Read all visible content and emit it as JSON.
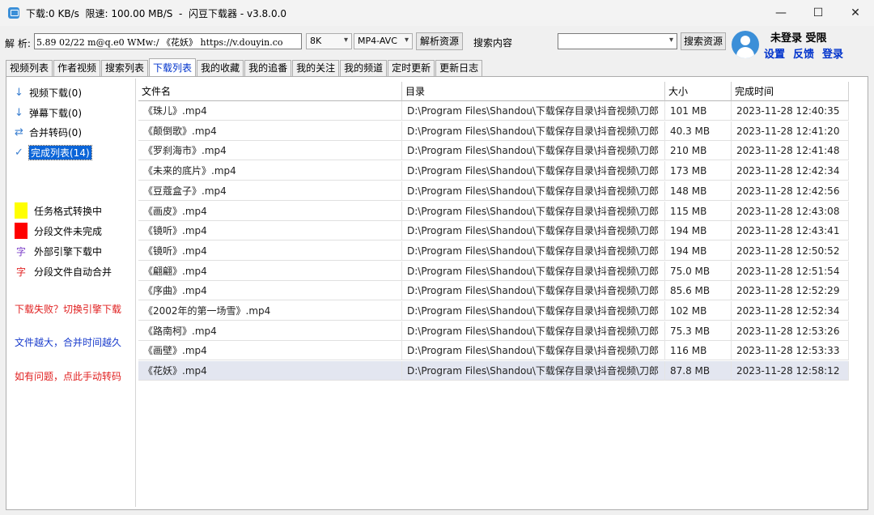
{
  "window": {
    "title": "下载:0 KB/s  限速: 100.00 MB/S  -  闪豆下载器 - v3.8.0.0",
    "controls": {
      "minimize": "—",
      "maximize": "☐",
      "close": "✕"
    }
  },
  "toolbar": {
    "parse_label": "解 析:",
    "url_value": "5.89 02/22 m@q.e0 WMw:/ 《花妖》  https://v.douyin.co",
    "quality_value": "8K",
    "format_value": "MP4-AVC",
    "parse_button": "解析资源",
    "search_label": "搜索内容",
    "search_value": "",
    "search_button": "搜索资源"
  },
  "user": {
    "status": "未登录  受限",
    "settings": "设置",
    "feedback": "反馈",
    "login": "登录"
  },
  "tabs": [
    {
      "label": "视频列表"
    },
    {
      "label": "作者视频"
    },
    {
      "label": "搜索列表"
    },
    {
      "label": "下载列表",
      "active": true
    },
    {
      "label": "我的收藏"
    },
    {
      "label": "我的追番"
    },
    {
      "label": "我的关注"
    },
    {
      "label": "我的频道"
    },
    {
      "label": "定时更新"
    },
    {
      "label": "更新日志"
    }
  ],
  "nav": [
    {
      "icon": "↓",
      "label": "视频下载(0)"
    },
    {
      "icon": "↓",
      "label": "弹幕下载(0)"
    },
    {
      "icon": "⇄",
      "label": "合并转码(0)"
    },
    {
      "icon": "✓",
      "label": "完成列表(14)",
      "selected": true
    }
  ],
  "legend": [
    {
      "color": "#ffff00",
      "label": "任务格式转换中"
    },
    {
      "color": "#ff0000",
      "label": "分段文件未完成"
    },
    {
      "char": "字",
      "char_color": "#7a3cc8",
      "label": "外部引擎下载中"
    },
    {
      "char": "字",
      "char_color": "#e02020",
      "label": "分段文件自动合并"
    }
  ],
  "notes": [
    {
      "text": "下载失败？切换引擎下载",
      "color": "#e02020"
    },
    {
      "text": "文件越大，合并时间越久",
      "color": "#1a3ccc"
    },
    {
      "text": "如有问题，点此手动转码",
      "color": "#e02020"
    }
  ],
  "table": {
    "columns": [
      "文件名",
      "目录",
      "大小",
      "完成时间"
    ],
    "rows": [
      {
        "name": "《珠儿》.mp4",
        "dir": "D:\\Program Files\\Shandou\\下载保存目录\\抖音视频\\刀郎",
        "size": "101 MB",
        "time": "2023-11-28 12:40:35"
      },
      {
        "name": "《颠倒歌》.mp4",
        "dir": "D:\\Program Files\\Shandou\\下载保存目录\\抖音视频\\刀郎",
        "size": "40.3 MB",
        "time": "2023-11-28 12:41:20"
      },
      {
        "name": "《罗刹海市》.mp4",
        "dir": "D:\\Program Files\\Shandou\\下载保存目录\\抖音视频\\刀郎",
        "size": "210 MB",
        "time": "2023-11-28 12:41:48"
      },
      {
        "name": "《未来的底片》.mp4",
        "dir": "D:\\Program Files\\Shandou\\下载保存目录\\抖音视频\\刀郎",
        "size": "173 MB",
        "time": "2023-11-28 12:42:34"
      },
      {
        "name": "《豆蔻盒子》.mp4",
        "dir": "D:\\Program Files\\Shandou\\下载保存目录\\抖音视频\\刀郎",
        "size": "148 MB",
        "time": "2023-11-28 12:42:56"
      },
      {
        "name": "《画皮》.mp4",
        "dir": "D:\\Program Files\\Shandou\\下载保存目录\\抖音视频\\刀郎",
        "size": "115 MB",
        "time": "2023-11-28 12:43:08"
      },
      {
        "name": "《镜听》.mp4",
        "dir": "D:\\Program Files\\Shandou\\下载保存目录\\抖音视频\\刀郎",
        "size": "194 MB",
        "time": "2023-11-28 12:43:41"
      },
      {
        "name": "《镜听》.mp4",
        "dir": "D:\\Program Files\\Shandou\\下载保存目录\\抖音视频\\刀郎",
        "size": "194 MB",
        "time": "2023-11-28 12:50:52"
      },
      {
        "name": "《翩翩》.mp4",
        "dir": "D:\\Program Files\\Shandou\\下载保存目录\\抖音视频\\刀郎",
        "size": "75.0 MB",
        "time": "2023-11-28 12:51:54"
      },
      {
        "name": "《序曲》.mp4",
        "dir": "D:\\Program Files\\Shandou\\下载保存目录\\抖音视频\\刀郎",
        "size": "85.6 MB",
        "time": "2023-11-28 12:52:29"
      },
      {
        "name": "《2002年的第一场雪》.mp4",
        "dir": "D:\\Program Files\\Shandou\\下载保存目录\\抖音视频\\刀郎",
        "size": "102 MB",
        "time": "2023-11-28 12:52:34"
      },
      {
        "name": "《路南柯》.mp4",
        "dir": "D:\\Program Files\\Shandou\\下载保存目录\\抖音视频\\刀郎",
        "size": "75.3 MB",
        "time": "2023-11-28 12:53:26"
      },
      {
        "name": "《画壁》.mp4",
        "dir": "D:\\Program Files\\Shandou\\下载保存目录\\抖音视频\\刀郎",
        "size": "116 MB",
        "time": "2023-11-28 12:53:33"
      },
      {
        "name": "《花妖》.mp4",
        "dir": "D:\\Program Files\\Shandou\\下载保存目录\\抖音视频\\刀郎",
        "size": "87.8 MB",
        "time": "2023-11-28 12:58:12",
        "selected": true
      }
    ]
  }
}
